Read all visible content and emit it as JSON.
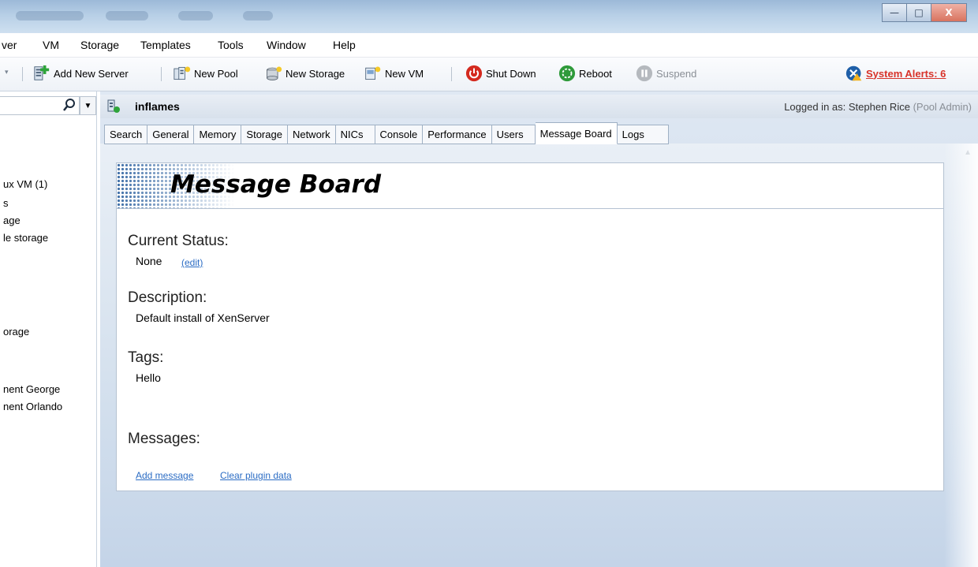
{
  "window": {
    "buttons": {
      "minimize": "—",
      "maximize": "□",
      "close": "X"
    }
  },
  "menubar": {
    "items": [
      "ver",
      "VM",
      "Storage",
      "Templates",
      "Tools",
      "Window",
      "Help"
    ]
  },
  "toolbar": {
    "add_new_server": "Add New Server",
    "new_pool": "New Pool",
    "new_storage": "New Storage",
    "new_vm": "New VM",
    "shut_down": "Shut Down",
    "reboot": "Reboot",
    "suspend": "Suspend",
    "system_alerts": "System Alerts: 6"
  },
  "sidebar": {
    "items": [
      "ux VM (1)",
      "s",
      "age",
      "le storage",
      "orage",
      "nent George",
      "nent Orlando"
    ]
  },
  "header": {
    "title": "inflames",
    "logged_in_label": "Logged in as:",
    "logged_in_user": "Stephen Rice",
    "logged_in_role": "(Pool Admin)"
  },
  "tabs": [
    {
      "label": "Search"
    },
    {
      "label": "General"
    },
    {
      "label": "Memory"
    },
    {
      "label": "Storage"
    },
    {
      "label": "Network"
    },
    {
      "label": "NICs"
    },
    {
      "label": "Console"
    },
    {
      "label": "Performance"
    },
    {
      "label": "Users"
    },
    {
      "label": "Message Board",
      "active": true
    },
    {
      "label": "Logs"
    }
  ],
  "board": {
    "title": "Message Board",
    "current_status_heading": "Current Status:",
    "current_status_value": "None",
    "edit_link": "(edit)",
    "description_heading": "Description:",
    "description_value": "Default install of XenServer",
    "tags_heading": "Tags:",
    "tags_value": "Hello",
    "messages_heading": "Messages:",
    "add_message_link": "Add message",
    "clear_plugin_link": "Clear plugin data"
  },
  "colors": {
    "link": "#2b6cc4",
    "alert": "#d8332a",
    "shutdown": "#d42a1f",
    "reboot": "#2e9a3a"
  }
}
